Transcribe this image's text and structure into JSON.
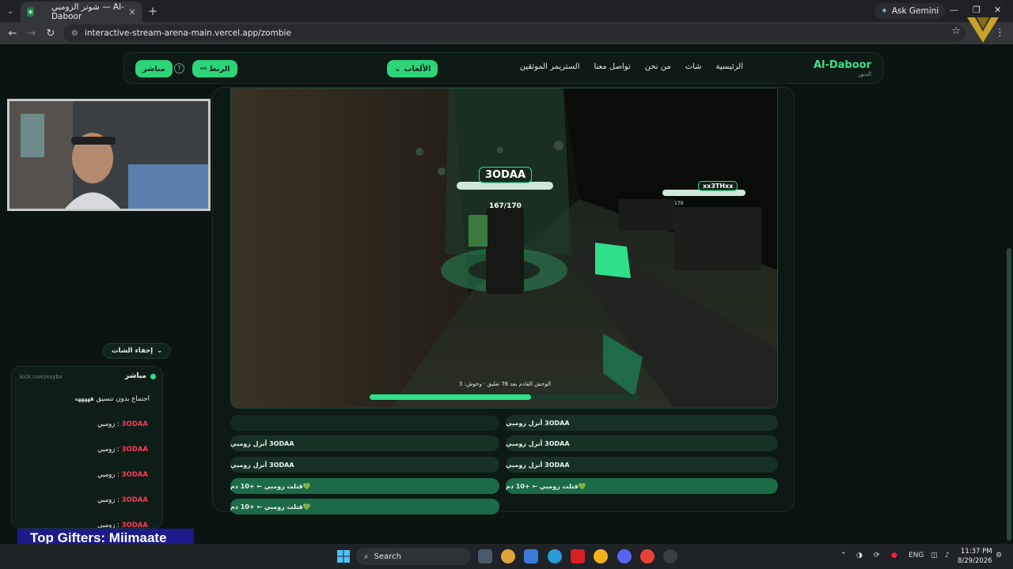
{
  "browser": {
    "tab_title": "شوتر الزومبي — Al-Daboor",
    "gemini_label": "Ask Gemini",
    "url": "interactive-stream-arena-main.vercel.app/zombie"
  },
  "site": {
    "brand": "Al-Daboor",
    "brand_sub": "الدبور",
    "nav": [
      "الرئيسية",
      "شات",
      "من نحن",
      "تواصل معنا",
      "الستريمر الموثقين"
    ],
    "games_label": "الألعاب",
    "link_label": "الربط",
    "live_label": "مباشر"
  },
  "game": {
    "player_name": "3ODAA",
    "player_hp": "167/170",
    "enemy_name": "xx3THxx",
    "enemy_hp": "170",
    "wave_status": "الوحش القادم بعد 76 تعليق · وحوش: 3",
    "wave_progress": 0.6
  },
  "feed": {
    "right": [
      "3ODAA أنزل زومبي",
      "3ODAA أنزل زومبي",
      "3ODAA أنزل زومبي",
      "💚قتلت زومبي ← +10 دم"
    ],
    "left": [
      "",
      "3ODAA أنزل زومبي",
      "3ODAA أنزل زومبي",
      "💚قتلت زومبي ← +10 دم",
      "💚قتلت زومبي ← +10 دم"
    ]
  },
  "chat": {
    "hide_label": "إخفاء الشات",
    "live_label": "مباشر",
    "channel_url": "kick.com/xsybx",
    "first_message": "اجتماع بدون تنسيق هههههه",
    "messages": [
      {
        "user": "3ODAA",
        "text": "زومبي"
      },
      {
        "user": "3ODAA",
        "text": "زومبي"
      },
      {
        "user": "3ODAA",
        "text": "زومبي"
      },
      {
        "user": "3ODAA",
        "text": "زومبي"
      },
      {
        "user": "3ODAA",
        "text": "زومبي"
      }
    ]
  },
  "overlay": {
    "top_gifters": "Top Gifters: Miimaate"
  },
  "taskbar": {
    "search_label": "Search",
    "lang": "ENG",
    "time": "11:37 PM",
    "date": "8/29/2026"
  },
  "colors": {
    "accent": "#2ed47a",
    "background": "#0a1512",
    "chat_user": "#ff3a5a"
  }
}
